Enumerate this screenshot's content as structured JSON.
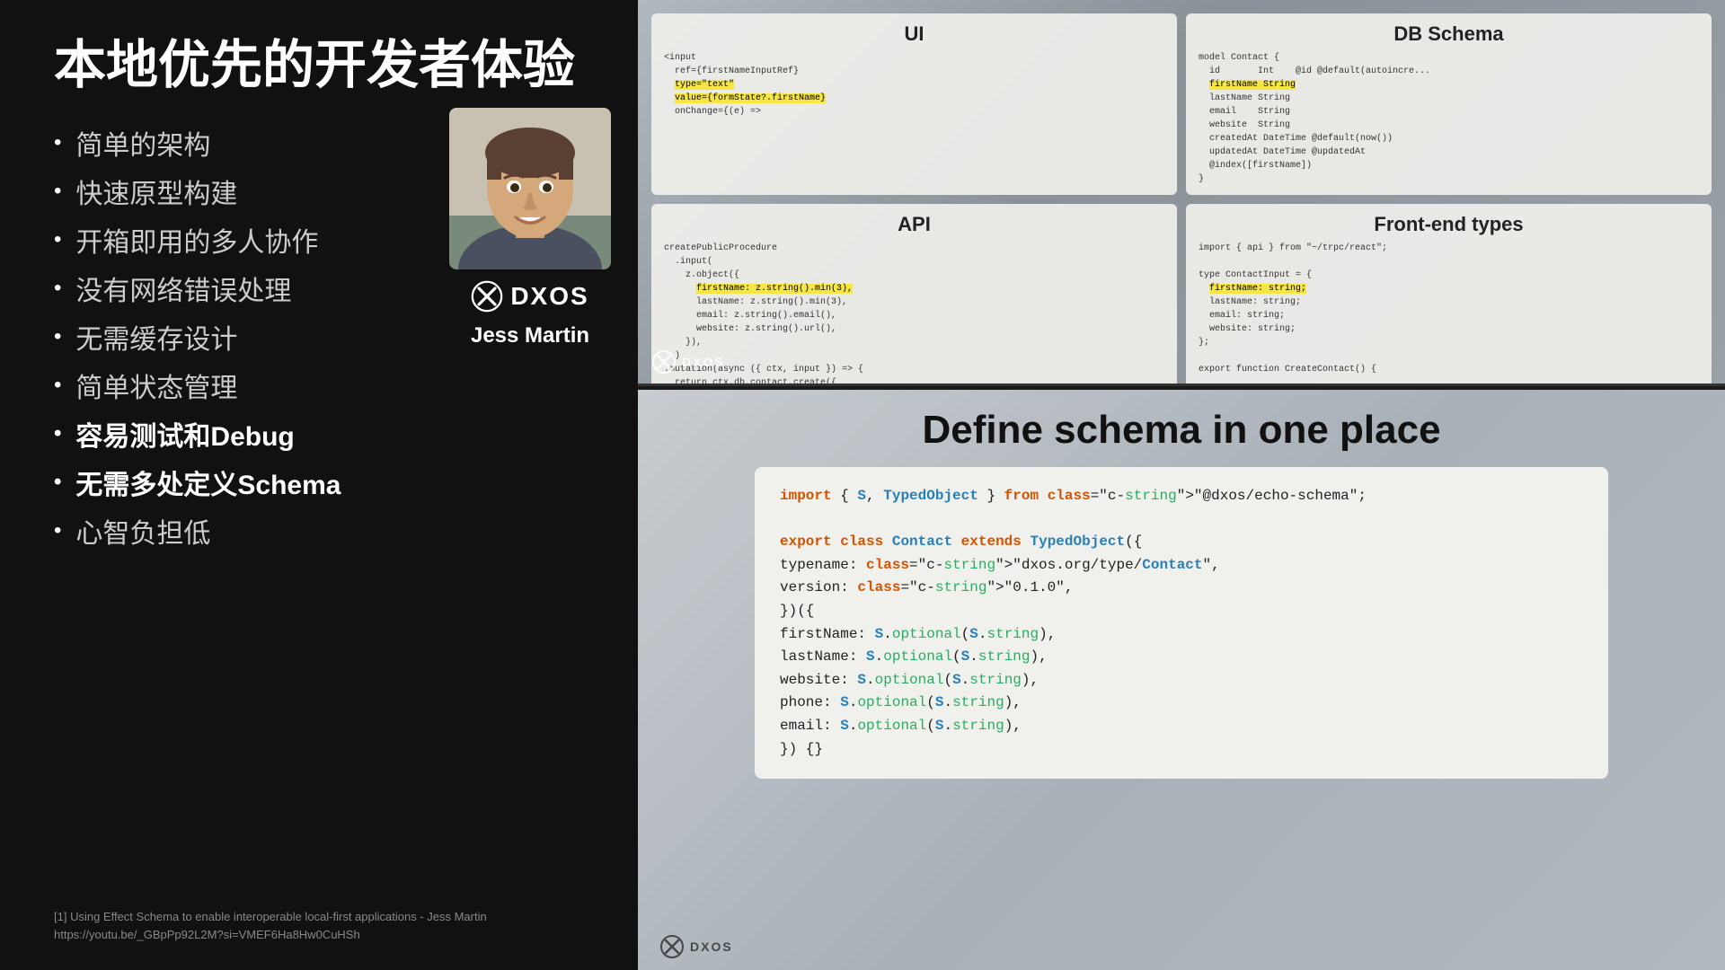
{
  "left": {
    "title": "本地优先的开发者体验",
    "bullets": [
      {
        "text": "简单的架构",
        "highlighted": false
      },
      {
        "text": "快速原型构建",
        "highlighted": false
      },
      {
        "text": "开箱即用的多人协作",
        "highlighted": false
      },
      {
        "text": "没有网络错误处理",
        "highlighted": false
      },
      {
        "text": "无需缓存设计",
        "highlighted": false
      },
      {
        "text": "简单状态管理",
        "highlighted": false
      },
      {
        "text": "容易测试和Debug",
        "highlighted": true
      },
      {
        "text": "无需多处定义Schema",
        "highlighted": true
      },
      {
        "text": "心智负担低",
        "highlighted": false
      }
    ],
    "presenter_name": "Jess Martin",
    "dxos_label": "DXOS",
    "footnote_line1": "[1] Using Effect Schema to enable interoperable local-first applications - Jess Martin",
    "footnote_line2": "https://youtu.be/_GBpPp92L2M?si=VMEF6Ha8Hw0CuHSh"
  },
  "right": {
    "top": {
      "ui_title": "UI",
      "api_title": "API",
      "db_title": "DB Schema",
      "frontend_title": "Front-end types",
      "dxos_label": "DXOS"
    },
    "bottom": {
      "schema_title": "Define schema in one place",
      "code_lines": [
        "import { S, TypedObject } from \"@dxos/echo-schema\";",
        "",
        "export class Contact extends TypedObject({",
        "  typename: \"dxos.org/type/Contact\",",
        "  version: \"0.1.0\",",
        "})({",
        "  firstName: S.optional(S.string),",
        "  lastName: S.optional(S.string),",
        "  website: S.optional(S.string),",
        "  phone: S.optional(S.string),",
        "  email: S.optional(S.string),",
        "}) {}"
      ],
      "dxos_label": "DXOS"
    }
  }
}
